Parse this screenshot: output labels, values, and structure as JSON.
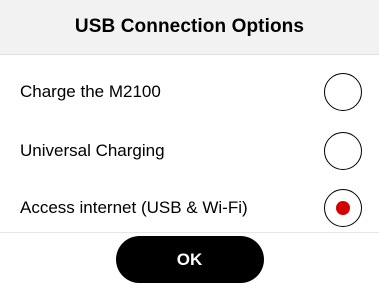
{
  "dialog": {
    "title": "USB Connection Options"
  },
  "options": [
    {
      "label": "Charge the M2100",
      "selected": false
    },
    {
      "label": "Universal Charging",
      "selected": false
    },
    {
      "label": "Access internet (USB & Wi-Fi)",
      "selected": true
    }
  ],
  "footer": {
    "ok_label": "OK"
  },
  "colors": {
    "header_bg": "#f2f2f2",
    "selected_dot": "#d50000",
    "button_bg": "#000000",
    "button_text": "#ffffff"
  }
}
